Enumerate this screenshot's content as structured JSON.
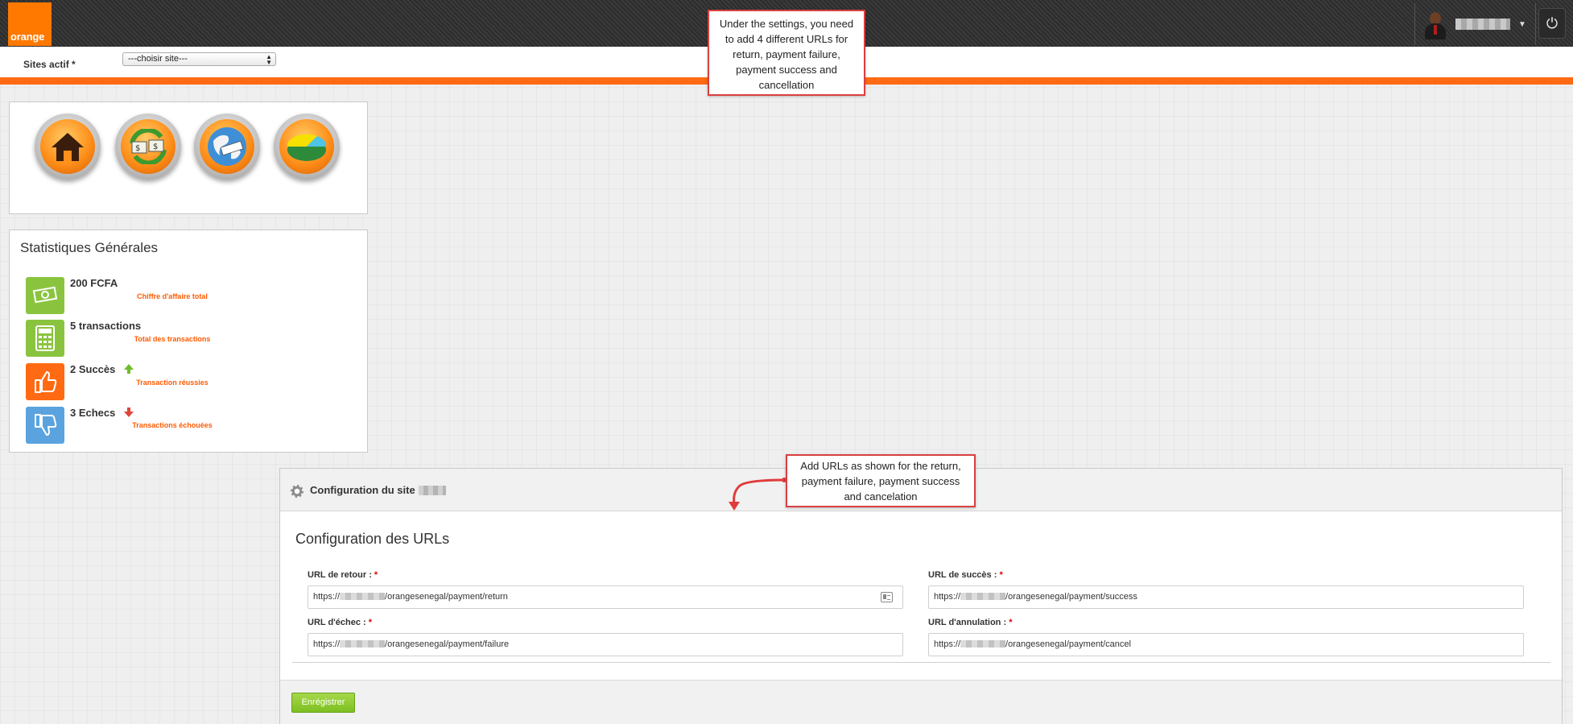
{
  "header": {
    "logo_text": "orange",
    "power_icon": "power-icon",
    "user_icon": "user-avatar"
  },
  "sitebar": {
    "label": "Sites actif *",
    "select_value": "---choisir site---"
  },
  "nav_icons": [
    "home-icon",
    "money-exchange-icon",
    "globe-icon",
    "pie-chart-icon"
  ],
  "stats": {
    "title": "Statistiques Générales",
    "rows": [
      {
        "value": "200 FCFA",
        "desc": "Chiffre d'affaire total",
        "icon": "money-icon",
        "color": "#8ac43f"
      },
      {
        "value": "5 transactions",
        "desc": "Total des transactions",
        "icon": "calculator-icon",
        "color": "#8ac43f"
      },
      {
        "value": "2 Succès",
        "desc": "Transaction réussies",
        "icon": "thumbs-up-icon",
        "color": "#ff6a13",
        "trend": "up"
      },
      {
        "value": "3 Echecs",
        "desc": "Transactions échouées",
        "icon": "thumbs-down-icon",
        "color": "#5aa3df",
        "trend": "down"
      }
    ]
  },
  "callouts": {
    "top": "Under the settings, you need to add 4 different URLs for return, payment failure, payment success and cancellation",
    "middle": "Add URLs as shown for the return, payment failure, payment success and cancelation"
  },
  "config": {
    "title": "Configuration du site",
    "urls_title": "Configuration des URLs",
    "fields": {
      "return": {
        "label": "URL de retour :",
        "prefix": "https://",
        "suffix": "/orangesenegal/payment/return"
      },
      "success": {
        "label": "URL de succès :",
        "prefix": "https://",
        "suffix": "/orangesenegal/payment/success"
      },
      "failure": {
        "label": "URL d'échec :",
        "prefix": "https://",
        "suffix": "/orangesenegal/payment/failure"
      },
      "cancel": {
        "label": "URL d'annulation :",
        "prefix": "https://",
        "suffix": "/orangesenegal/payment/cancel"
      }
    },
    "required_mark": "*",
    "save_label": "Enrégistrer"
  },
  "colors": {
    "brand_orange": "#ff7900",
    "strip_orange": "#ff6a13",
    "callout_border": "#d94040",
    "save_green": "#7cbf21"
  }
}
